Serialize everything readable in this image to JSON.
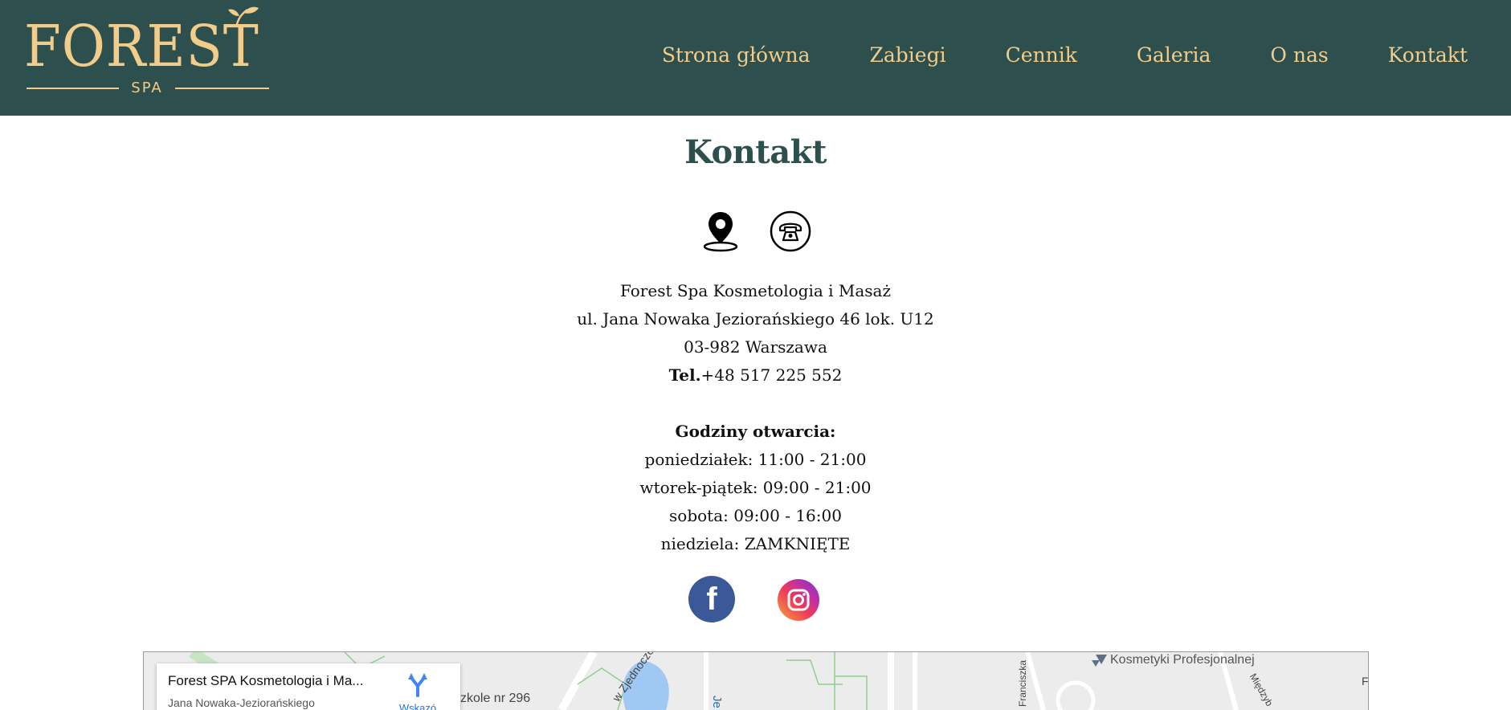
{
  "colors": {
    "header_bg": "#2d4f4d",
    "accent_gold": "#f1cc8a",
    "title_color": "#2d4f4d",
    "facebook": "#3b5998"
  },
  "header": {
    "logo": {
      "word": "FOREST",
      "sub": "SPA"
    },
    "nav": [
      {
        "label": "Strona główna"
      },
      {
        "label": "Zabiegi"
      },
      {
        "label": "Cennik"
      },
      {
        "label": "Galeria"
      },
      {
        "label": "O nas"
      },
      {
        "label": "Kontakt"
      }
    ]
  },
  "main": {
    "title": "Kontakt",
    "icons": [
      "map-pin-icon",
      "phone-icon"
    ],
    "address": {
      "name": "Forest Spa Kosmetologia i Masaż",
      "street": "ul. Jana Nowaka Jeziorańskiego 46 lok. U12",
      "city": "03-982 Warszawa",
      "phone_label": "Tel.",
      "phone": "+48 517 225 552"
    },
    "hours": {
      "heading": "Godziny otwarcia:",
      "rows": [
        "poniedziałek: 11:00 - 21:00",
        "wtorek-piątek: 09:00 - 21:00",
        "sobota: 09:00 - 16:00",
        "niedziela: ZAMKNIĘTE"
      ]
    },
    "social": [
      "facebook-icon",
      "instagram-icon"
    ]
  },
  "map": {
    "card_title": "Forest SPA Kosmetologia i Ma...",
    "card_address": "Jana Nowaka-Jeziorańskiego",
    "directions_label": "Wskazó",
    "labels": {
      "school": "zkole nr 296",
      "street_diag": "w Zjednoczon",
      "lake": "Je",
      "franciszka": "Franciszka",
      "poi": "Kosmetyki Profesjonalnej",
      "miedzyb": "Międzyb",
      "edge": "F"
    }
  }
}
